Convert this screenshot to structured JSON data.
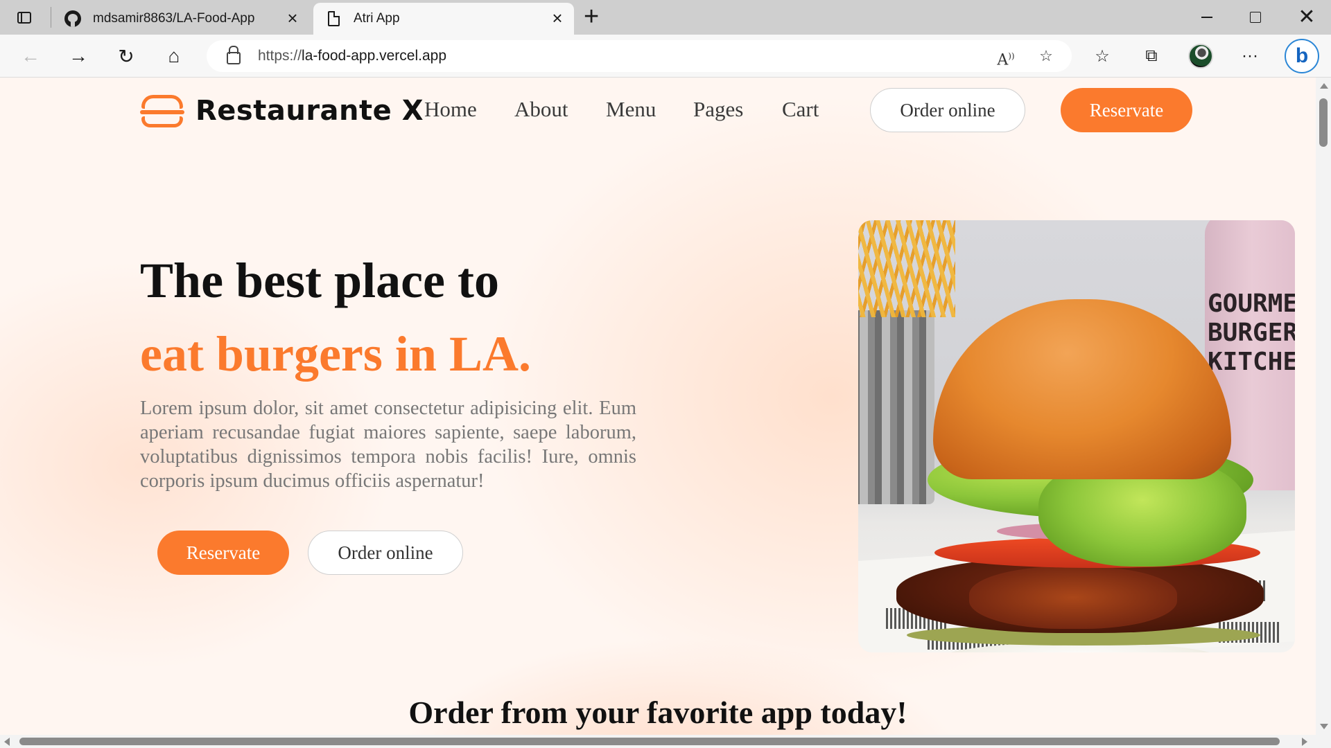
{
  "browser": {
    "tabs": [
      {
        "title": "mdsamir8863/LA-Food-App",
        "favicon": "github-icon"
      },
      {
        "title": "Atri App",
        "favicon": "document-icon",
        "active": true
      }
    ],
    "address": {
      "protocol": "https://",
      "host": "la-food-app.vercel.app"
    }
  },
  "site": {
    "brand": "Restaurante X",
    "nav": [
      "Home",
      "About",
      "Menu",
      "Pages",
      "Cart"
    ],
    "nav_order_label": "Order online",
    "nav_reserve_label": "Reservate"
  },
  "hero": {
    "title_line1": "The best place to",
    "title_line2": "eat burgers in LA.",
    "body": "Lorem ipsum dolor, sit amet consectetur adipisicing elit. Eum aperiam recusandae fugiat maiores sapiente, saepe laborum, voluptatibus dignissimos tempora nobis facilis! Iure, omnis corporis ipsum ducimus officiis aspernatur!",
    "reserve_label": "Reservate",
    "order_label": "Order online",
    "image_cup_text": "GOURMET\nBURGER\nKITCHEN"
  },
  "section": {
    "title": "Order from your favorite app today!"
  },
  "colors": {
    "accent": "#fb7a2d",
    "heading": "#111111",
    "body_text": "#777777"
  }
}
